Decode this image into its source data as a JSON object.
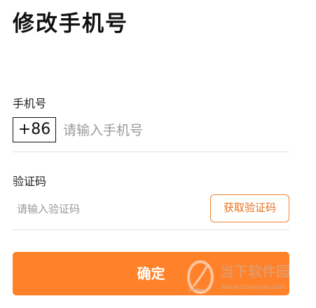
{
  "header": {
    "title": "修改手机号"
  },
  "phone": {
    "label": "手机号",
    "country_code": "+86",
    "placeholder": "请输入手机号",
    "value": ""
  },
  "verification": {
    "label": "验证码",
    "placeholder": "请输入验证码",
    "value": "",
    "get_code_label": "获取验证码"
  },
  "confirm": {
    "label": "确定"
  },
  "watermark": {
    "text": "当下软件园",
    "url": "www.downxia.com",
    "icon": "leaf-logo-icon"
  },
  "colors": {
    "accent": "#ff822b",
    "accent_text": "#e8701e",
    "divider": "#e2e2e2",
    "placeholder": "#9a9a9a"
  }
}
